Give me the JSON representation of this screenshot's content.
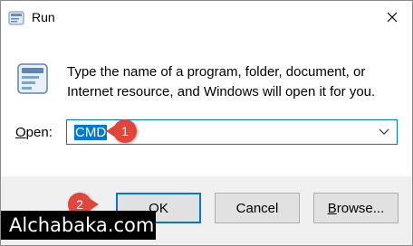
{
  "window": {
    "title": "Run",
    "close_symbol": "✕",
    "accent_color": "#0078d7"
  },
  "icons": {
    "app": "run-app-icon",
    "run": "run-dialog-icon",
    "close": "close-icon",
    "dropdown": "chevron-down-icon"
  },
  "dialog": {
    "description_line1": "Type the name of a program, folder, document, or",
    "description_line2": "Internet resource, and Windows will open it for you.",
    "open_label_first": "O",
    "open_label_rest": "pen:",
    "open_value": "CMD"
  },
  "buttons": {
    "ok": "OK",
    "cancel": "Cancel",
    "browse_first": "B",
    "browse_rest": "rowse..."
  },
  "annotations": {
    "step1": "1",
    "step2": "2",
    "marker_color": "#e0473a"
  },
  "watermark": {
    "text": "Alchabaka.com"
  }
}
